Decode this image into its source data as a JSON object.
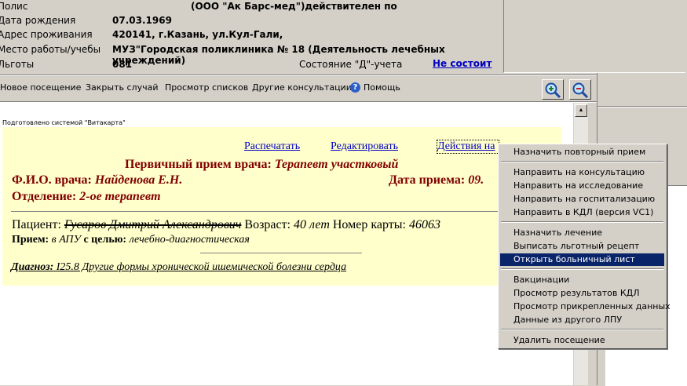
{
  "patient_info": {
    "policy_label": "Полис",
    "policy_value": "(ООО \"Ак Барс-мед\")действителен по",
    "dob_label": "Дата рождения",
    "dob_value": "07.03.1969",
    "address_label": "Адрес проживания",
    "address_value": "420141, г.Казань, ул.Кул-Гали,",
    "work_label": "Место работы/учебы",
    "work_value": "МУЗ\"Городская поликлиника № 18 (Деятельность лечебных учреждений)",
    "benefits_label": "Льготы",
    "benefits_value": "081",
    "d_status_label": "Состояние \"Д\"-учета",
    "d_status_link": "Не состоит"
  },
  "toolbar": {
    "new_visit": "Новое посещение",
    "close_case": "Закрыть случай",
    "view_lists": "Просмотр списков",
    "other_consult": "Другие консультации",
    "help": "Помощь",
    "help_icon": "help-icon",
    "zoom_in_icon": "zoom-in-icon",
    "zoom_out_icon": "zoom-out-icon"
  },
  "document": {
    "prepared_by": "Подготовлено системой \"Витакарта\"",
    "print_link": "Распечатать",
    "edit_link": "Редактировать",
    "actions_link": "Действия на",
    "heading_prefix": "Первичный прием врача:",
    "heading_spec": "Терапевт участковый",
    "doctor_label": "Ф.И.О. врача:",
    "doctor_value": "Найденова Е.Н.",
    "date_label": "Дата приема:",
    "date_value": "09.",
    "dept_label": "Отделение:",
    "dept_value": "2-ое терапевт",
    "patient_label": "Пациент:",
    "patient_name": "Гусаров Дмитрий Александрович",
    "age_label": "Возраст:",
    "age_value": "40 лет",
    "card_label": "Номер карты:",
    "card_value": "46063",
    "reception_label": "Прием:",
    "reception_place": "в АПУ",
    "purpose_label": "с целью:",
    "purpose_value": "лечебно-диагностическая",
    "diagnosis_label": "Диагноз:",
    "diagnosis_value": "I25.8 Другие формы хронической ишемической болезни сердца"
  },
  "context_menu": {
    "items": [
      "Назначить повторный прием",
      "Направить на консультацию",
      "Направить на исследование",
      "Направить на госпитализацию",
      "Направить в КДЛ (версия VC1)",
      "Назначить лечение",
      "Выписать льготный рецепт",
      "Открыть больничный лист",
      "Вакцинации",
      "Просмотр результатов КДЛ",
      "Просмотр прикрепленных данных",
      "Данные из другого ЛПУ",
      "Удалить посещение"
    ],
    "selected": "Открыть больничный лист"
  },
  "colors": {
    "doc_bg": "#ffffcc",
    "heading_red": "#800000",
    "menu_highlight": "#0a246a",
    "link_blue": "#0000c0"
  }
}
